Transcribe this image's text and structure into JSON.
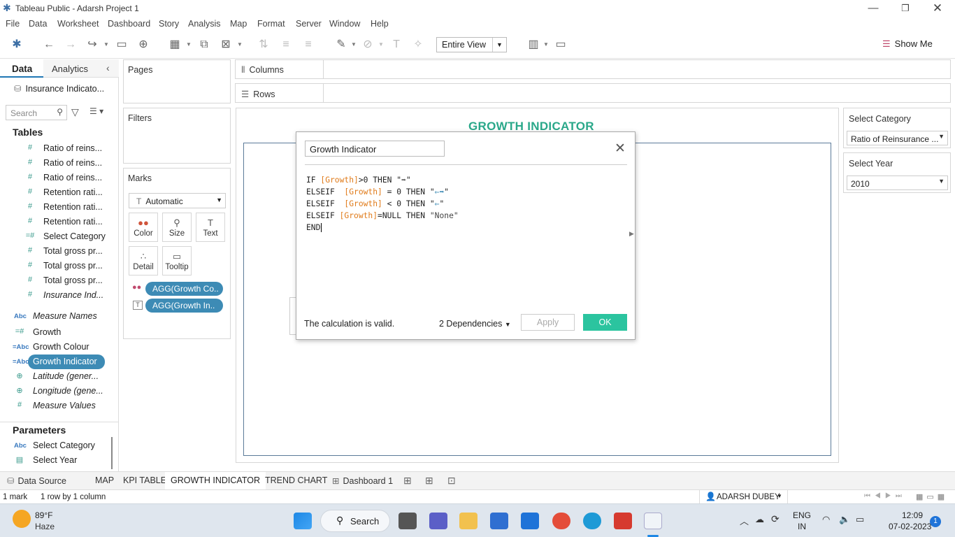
{
  "window": {
    "title": "Tableau Public - Adarsh Project 1"
  },
  "menu": [
    "File",
    "Data",
    "Worksheet",
    "Dashboard",
    "Story",
    "Analysis",
    "Map",
    "Format",
    "Server",
    "Window",
    "Help"
  ],
  "toolbar": {
    "view_mode": "Entire View",
    "show_me": "Show Me"
  },
  "left_pane": {
    "tab_data": "Data",
    "tab_analytics": "Analytics",
    "datasource": "Insurance Indicato...",
    "search_placeholder": "Search",
    "tables_heading": "Tables",
    "table_fields": [
      {
        "icon": "#",
        "name": "Ratio of reins..."
      },
      {
        "icon": "#",
        "name": "Ratio of reins..."
      },
      {
        "icon": "#",
        "name": "Ratio of reins..."
      },
      {
        "icon": "#",
        "name": "Retention rati..."
      },
      {
        "icon": "#",
        "name": "Retention rati..."
      },
      {
        "icon": "#",
        "name": "Retention rati..."
      },
      {
        "icon": "=#",
        "name": "Select Category"
      },
      {
        "icon": "#",
        "name": "Total gross pr..."
      },
      {
        "icon": "#",
        "name": "Total gross pr..."
      },
      {
        "icon": "#",
        "name": "Total gross pr..."
      },
      {
        "icon": "#",
        "name": "Insurance Ind..."
      }
    ],
    "measure_fields": [
      {
        "icon": "Abc",
        "name": "Measure Names"
      },
      {
        "icon": "=#",
        "name": "Growth"
      },
      {
        "icon": "=Abc",
        "name": "Growth Colour"
      },
      {
        "icon": "=Abc",
        "name": "Growth Indicator"
      },
      {
        "icon": "globe",
        "name": "Latitude (gener..."
      },
      {
        "icon": "globe",
        "name": "Longitude (gene..."
      },
      {
        "icon": "#",
        "name": "Measure Values"
      }
    ],
    "parameters_heading": "Parameters",
    "parameters": [
      {
        "icon": "Abc",
        "name": "Select Category"
      },
      {
        "icon": "calendar",
        "name": "Select Year"
      }
    ]
  },
  "cards": {
    "pages": "Pages",
    "filters": "Filters",
    "marks": "Marks",
    "mark_type": "Automatic",
    "mark_buttons": [
      "Color",
      "Size",
      "Text",
      "Detail",
      "Tooltip"
    ],
    "pills": [
      "AGG(Growth Co..",
      "AGG(Growth In.."
    ]
  },
  "shelves": {
    "columns": "Columns",
    "rows": "Rows"
  },
  "view": {
    "title": "GROWTH INDICATOR"
  },
  "parameter_controls": {
    "category_label": "Select Category",
    "category_value": "Ratio of Reinsurance ...",
    "year_label": "Select Year",
    "year_value": "2010"
  },
  "calc_dialog": {
    "name": "Growth Indicator",
    "lines": [
      [
        "IF ",
        "[Growth]",
        ">0 THEN \"",
        "➡",
        "\""
      ],
      [
        "ELSEIF  ",
        "[Growth]",
        " = 0 THEN \"",
        "⇐➡",
        "\""
      ],
      [
        "ELSEIF  ",
        "[Growth]",
        " < 0 THEN \"",
        "⇐",
        "\""
      ],
      [
        "ELSEIF ",
        "[Growth]",
        "=NULL THEN ",
        "\"None\"",
        ""
      ],
      [
        "END",
        "",
        "",
        "",
        ""
      ]
    ],
    "status": "The calculation is valid.",
    "dependencies": "2 Dependencies",
    "apply": "Apply",
    "ok": "OK"
  },
  "sheet_tabs": {
    "datasource": "Data Source",
    "tabs": [
      "MAP",
      "KPI TABLE",
      "GROWTH INDICATOR",
      "TREND CHART",
      "Dashboard 1"
    ],
    "active": "GROWTH INDICATOR"
  },
  "status_bar": {
    "marks": "1 mark",
    "dims": "1 row by 1 column",
    "user": "ADARSH DUBEY"
  },
  "taskbar": {
    "weather_temp": "89°F",
    "weather_desc": "Haze",
    "search": "Search",
    "lang_top": "ENG",
    "lang_bottom": "IN",
    "time": "12:09",
    "date": "07-02-2023",
    "notif": "1"
  }
}
